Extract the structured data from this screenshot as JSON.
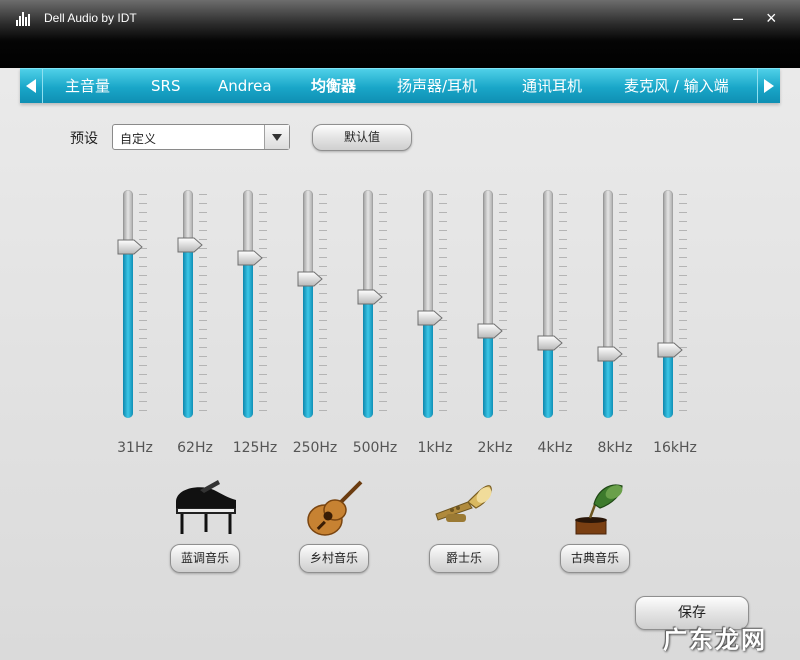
{
  "window": {
    "title": "Dell Audio by IDT",
    "minimize": "–",
    "close": "×"
  },
  "tabs": [
    {
      "label": "主音量"
    },
    {
      "label": "SRS"
    },
    {
      "label": "Andrea"
    },
    {
      "label": "均衡器",
      "active": true
    },
    {
      "label": "扬声器/耳机"
    },
    {
      "label": "通讯耳机"
    },
    {
      "label": "麦克风 / 输入端"
    }
  ],
  "preset": {
    "label": "预设",
    "selected": "自定义",
    "default_button": "默认值"
  },
  "equalizer": {
    "bands": [
      {
        "label": "31Hz",
        "level": 0.75
      },
      {
        "label": "62Hz",
        "level": 0.76
      },
      {
        "label": "125Hz",
        "level": 0.7
      },
      {
        "label": "250Hz",
        "level": 0.61
      },
      {
        "label": "500Hz",
        "level": 0.53
      },
      {
        "label": "1kHz",
        "level": 0.44
      },
      {
        "label": "2kHz",
        "level": 0.38
      },
      {
        "label": "4kHz",
        "level": 0.33
      },
      {
        "label": "8kHz",
        "level": 0.28
      },
      {
        "label": "16kHz",
        "level": 0.3
      }
    ]
  },
  "genres": [
    {
      "label": "蓝调音乐",
      "icon": "grand-piano-icon"
    },
    {
      "label": "乡村音乐",
      "icon": "acoustic-guitar-icon"
    },
    {
      "label": "爵士乐",
      "icon": "trumpet-icon"
    },
    {
      "label": "古典音乐",
      "icon": "gramophone-icon"
    }
  ],
  "save_label": "保存",
  "watermark": "广东龙网",
  "colors": {
    "accent": "#19a6c8",
    "fill": "#1fb0d6",
    "titlebar": "#000000"
  }
}
